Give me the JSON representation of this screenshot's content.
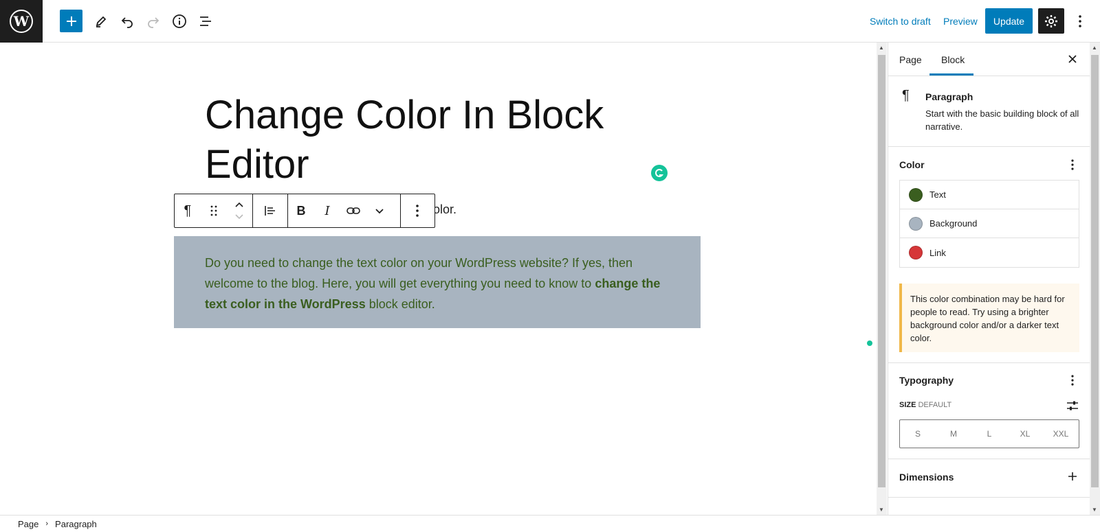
{
  "topbar": {
    "switch_to_draft": "Switch to draft",
    "preview": "Preview",
    "update": "Update"
  },
  "editor": {
    "title": "Change Color In Block Editor",
    "fragment_text": "olor.",
    "paragraph": {
      "part1": "Do you need to change the text color on your WordPress website? If yes, then welcome to the blog. Here, you will get everything you need to know to ",
      "bold": "change the text color in the WordPress",
      "part2": " block editor."
    }
  },
  "sidebar": {
    "tabs": [
      "Page",
      "Block"
    ],
    "active_tab": "Block",
    "block": {
      "title": "Paragraph",
      "description": "Start with the basic building block of all narrative."
    },
    "color": {
      "title": "Color",
      "items": [
        {
          "label": "Text",
          "color": "#3a5e1f"
        },
        {
          "label": "Background",
          "color": "#a8b4c0"
        },
        {
          "label": "Link",
          "color": "#d63638"
        }
      ]
    },
    "notice": "This color combination may be hard for people to read. Try using a brighter background color and/or a darker text color.",
    "typography": {
      "title": "Typography",
      "size_label": "SIZE",
      "size_value": "DEFAULT",
      "sizes": [
        "S",
        "M",
        "L",
        "XL",
        "XXL"
      ]
    },
    "dimensions": {
      "title": "Dimensions"
    }
  },
  "breadcrumb": [
    "Page",
    "Paragraph"
  ],
  "colors": {
    "accent": "#007cba",
    "dark": "#1e1e1e",
    "grammarly": "#15c39a"
  }
}
